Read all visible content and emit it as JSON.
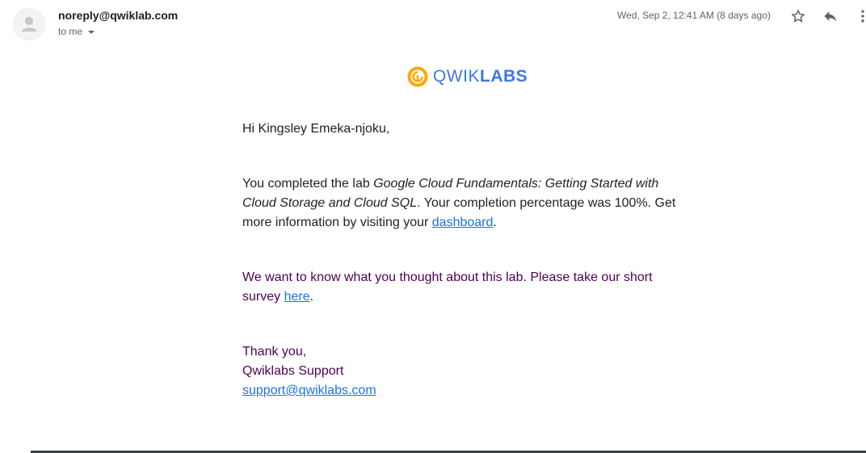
{
  "header": {
    "sender": "noreply@qwiklab.com",
    "recipient": "to me",
    "date": "Wed, Sep 2, 12:41 AM (8 days ago)"
  },
  "logo": {
    "part1": "QWIK",
    "part2": "LABS",
    "ring_color": "#f9ab00",
    "text_color": "#3b78e7"
  },
  "email": {
    "greeting": "Hi Kingsley Emeka-njoku,",
    "completion_prefix": "You completed the lab ",
    "lab_name": "Google Cloud Fundamentals: Getting Started with Cloud Storage and Cloud SQL",
    "completion_middle": ". Your completion percentage was 100%. Get more information by visiting your ",
    "dashboard_link": "dashboard",
    "completion_end": ".",
    "survey_prefix": "We want to know what you thought about this lab. Please take our short survey ",
    "survey_link": "here",
    "survey_end": ".",
    "thanks": "Thank you,",
    "signature": "Qwiklabs Support",
    "support_email": "support@qwiklabs.com"
  },
  "colors": {
    "link": "#1a73e8",
    "quoted_text": "#500050"
  }
}
